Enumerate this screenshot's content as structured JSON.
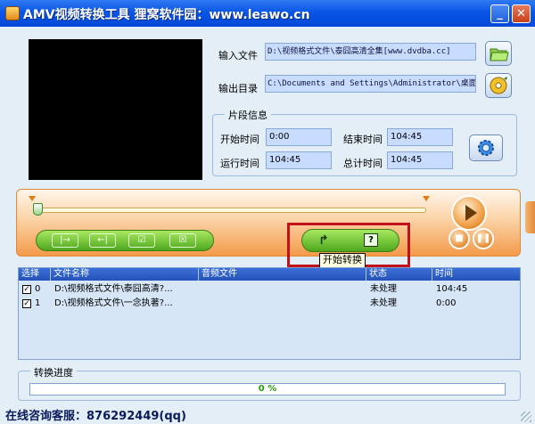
{
  "window": {
    "title": "AMV视频转换工具  狸窝软件园：www.leawo.cn",
    "minimize_label": "_",
    "close_label": "✕"
  },
  "files": {
    "input_label": "输入文件",
    "input_value": "D:\\视频格式文件\\泰囧高清全集[www.dvdba.cc]",
    "output_label": "输出目录",
    "output_value": "C:\\Documents and Settings\\Administrator\\桌面"
  },
  "segment": {
    "title": "片段信息",
    "start_label": "开始时间",
    "start_value": "0:00",
    "end_label": "结束时间",
    "end_value": "104:45",
    "run_label": "运行时间",
    "run_value": "104:45",
    "total_label": "总计时间",
    "total_value": "104:45"
  },
  "controls": {
    "set_start_glyph": "|→",
    "set_end_glyph": "←|",
    "check_glyph": "☑",
    "clear_glyph": "☒",
    "convert_glyph": "↱",
    "help_glyph": "?",
    "stop_glyph": "■",
    "pause_glyph": "❚❚",
    "tooltip": "开始转换",
    "slider_position": 0
  },
  "table": {
    "columns": [
      "选择",
      "文件名称",
      "音频文件",
      "状态",
      "时间"
    ],
    "rows": [
      {
        "checked": "✓",
        "index": "0",
        "name": "D:\\视频格式文件\\泰囧高清?...",
        "audio": "",
        "status": "未处理",
        "time": "104:45"
      },
      {
        "checked": "✓",
        "index": "1",
        "name": "D:\\视频格式文件\\一念执著?...",
        "audio": "",
        "status": "未处理",
        "time": "0:00"
      }
    ]
  },
  "progress": {
    "title": "转换进度",
    "value_text": "0 %",
    "fraction": 0
  },
  "footer": {
    "contact": "在线咨询客服：876292449(qq)"
  },
  "colors": {
    "title_bar": "#0a56e6",
    "accent_orange": "#f39a4a",
    "accent_green": "#4ea81e",
    "highlight_red": "#c0121a"
  }
}
